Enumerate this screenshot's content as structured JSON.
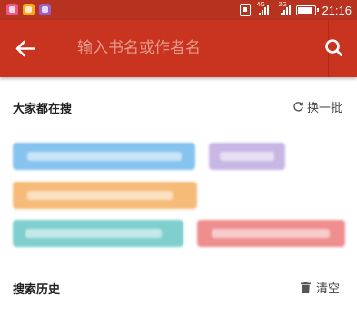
{
  "status_bar": {
    "time": "21:16",
    "signal1_label": "4G",
    "signal2_label": "2G"
  },
  "header": {
    "back_icon": "arrow-left-icon",
    "search_placeholder": "输入书名或作者名",
    "search_icon": "search-icon"
  },
  "hot_search": {
    "title": "大家都在搜",
    "refresh_label": "换一批",
    "refresh_icon": "refresh-icon",
    "tags": [
      {
        "color": "#86c3ee"
      },
      {
        "color": "#c8b7e4"
      },
      {
        "color": "#f6bb78"
      },
      {
        "color": "#7fcfcf"
      },
      {
        "color": "#ee8e8e"
      }
    ]
  },
  "history": {
    "title": "搜索历史",
    "clear_label": "清空",
    "clear_icon": "trash-icon"
  },
  "colors": {
    "status_bar": "#b7321f",
    "header": "#c8341f"
  }
}
